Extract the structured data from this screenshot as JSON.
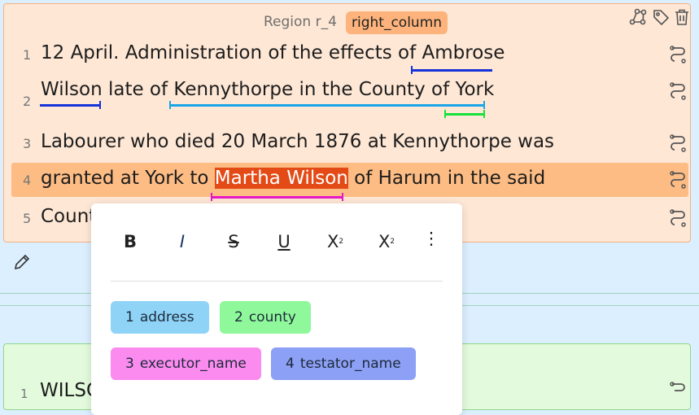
{
  "region": {
    "title": "Region r_4",
    "tag": "right_column",
    "lines": [
      {
        "num": "1",
        "text": "12 April. Administration of the effects of Ambrose"
      },
      {
        "num": "2",
        "text": "Wilson late of Kennythorpe in the County of York"
      },
      {
        "num": "3",
        "text": "Labourer who died 20 March 1876 at Kennythorpe was"
      },
      {
        "num": "4",
        "pre": "granted at York to ",
        "highlight": "Martha Wilson",
        "post": " of Harum in the said"
      },
      {
        "num": "5",
        "text": "Count"
      }
    ]
  },
  "region2": {
    "line1_num": "1",
    "line1_text": "WILSO"
  },
  "toolbar": {
    "bold": "B",
    "italic": "I",
    "strike": "S",
    "underline": "U",
    "subscript_base": "X",
    "subscript_mark": "2",
    "superscript_base": "X",
    "superscript_mark": "2",
    "more": "⋮"
  },
  "tags": [
    {
      "num": "1",
      "label": "address",
      "color": "#8fd3f7"
    },
    {
      "num": "2",
      "label": "county",
      "color": "#8ef89b"
    },
    {
      "num": "3",
      "label": "executor_name",
      "color": "#fb8bef"
    },
    {
      "num": "4",
      "label": "testator_name",
      "color": "#8ca0f5"
    }
  ],
  "underline_colors": {
    "testator": "#1533d9",
    "address": "#1aa5e8",
    "county": "#16e23b",
    "executor": "#e516c8"
  },
  "icons": [
    "graph-icon",
    "tag-icon",
    "trash-icon",
    "link-icon",
    "pencil-icon"
  ]
}
